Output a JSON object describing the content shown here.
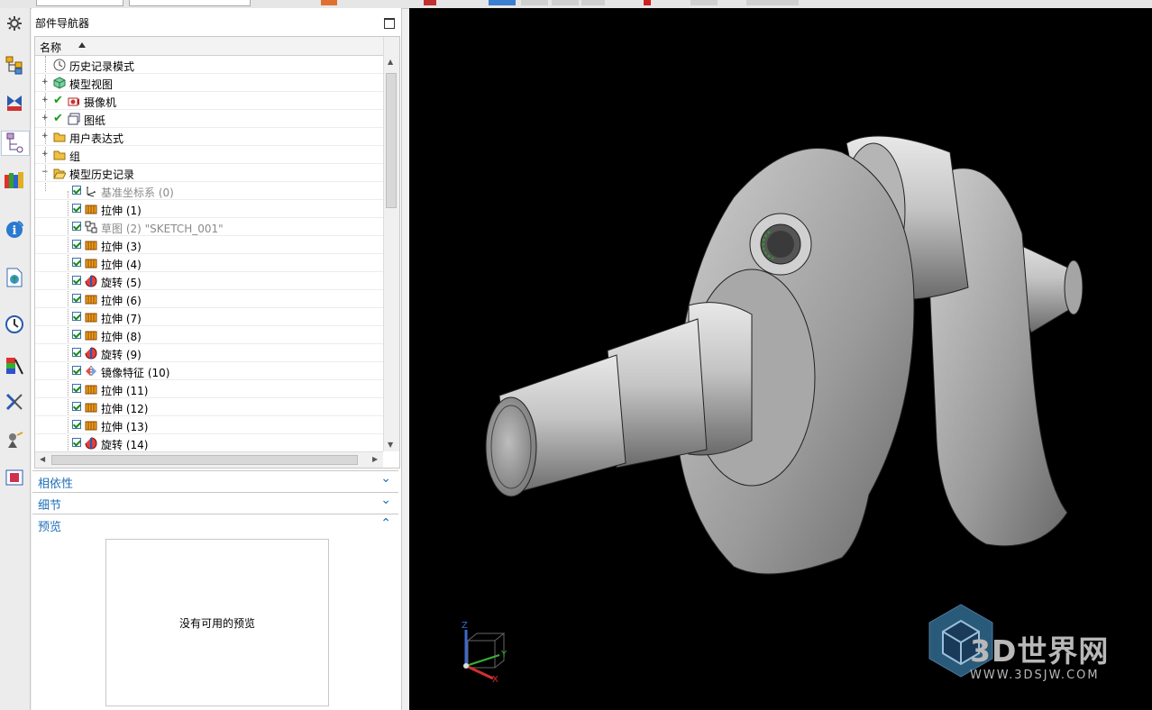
{
  "navigator": {
    "title": "部件导航器",
    "column_header": "名称",
    "rows": [
      {
        "label": "历史记录模式",
        "icon": "history-mode-icon"
      },
      {
        "label": "模型视图",
        "icon": "model-views-icon"
      },
      {
        "label": "摄像机",
        "icon": "camera-icon"
      },
      {
        "label": "图纸",
        "icon": "drawing-sheet-icon"
      },
      {
        "label": "用户表达式",
        "icon": "folder-icon"
      },
      {
        "label": "组",
        "icon": "folder-icon"
      },
      {
        "label": "模型历史记录",
        "icon": "folder-open-icon"
      },
      {
        "label": "基准坐标系 (0)",
        "icon": "datum-csys-icon"
      },
      {
        "label": "拉伸 (1)",
        "icon": "extrude-icon"
      },
      {
        "label": "草图 (2) \"SKETCH_001\"",
        "icon": "sketch-icon"
      },
      {
        "label": "拉伸 (3)",
        "icon": "extrude-icon"
      },
      {
        "label": "拉伸 (4)",
        "icon": "extrude-icon"
      },
      {
        "label": "旋转 (5)",
        "icon": "revolve-icon"
      },
      {
        "label": "拉伸 (6)",
        "icon": "extrude-icon"
      },
      {
        "label": "拉伸 (7)",
        "icon": "extrude-icon"
      },
      {
        "label": "拉伸 (8)",
        "icon": "extrude-icon"
      },
      {
        "label": "旋转 (9)",
        "icon": "revolve-icon"
      },
      {
        "label": "镜像特征 (10)",
        "icon": "mirror-feature-icon"
      },
      {
        "label": "拉伸 (11)",
        "icon": "extrude-icon"
      },
      {
        "label": "拉伸 (12)",
        "icon": "extrude-icon"
      },
      {
        "label": "拉伸 (13)",
        "icon": "extrude-icon"
      },
      {
        "label": "旋转 (14)",
        "icon": "revolve-icon"
      }
    ],
    "sections": {
      "dependencies": "相依性",
      "details": "细节",
      "preview": "预览"
    },
    "preview_message": "没有可用的预览"
  },
  "viewport": {
    "background_color": "#000000",
    "model": "crankshaft",
    "triad_labels": {
      "z": "Z",
      "y": "Y",
      "x": "X"
    },
    "watermark": {
      "text": "3D世界网",
      "url": "WWW.3DSJW.COM"
    }
  },
  "rail_icons": [
    "settings-gear-icon",
    "assembly-navigator-icon",
    "constraint-navigator-icon",
    "part-navigator-icon",
    "reuse-library-icon",
    "hd3d-tools-icon",
    "web-browser-icon",
    "history-icon",
    "system-materials-icon",
    "process-studio-icon",
    "manufacturing-wizards-icon",
    "roles-icon"
  ],
  "colors": {
    "section_title": "#1f6fb8",
    "check_green": "#1a9a1a",
    "viewport_bg": "#000000"
  }
}
